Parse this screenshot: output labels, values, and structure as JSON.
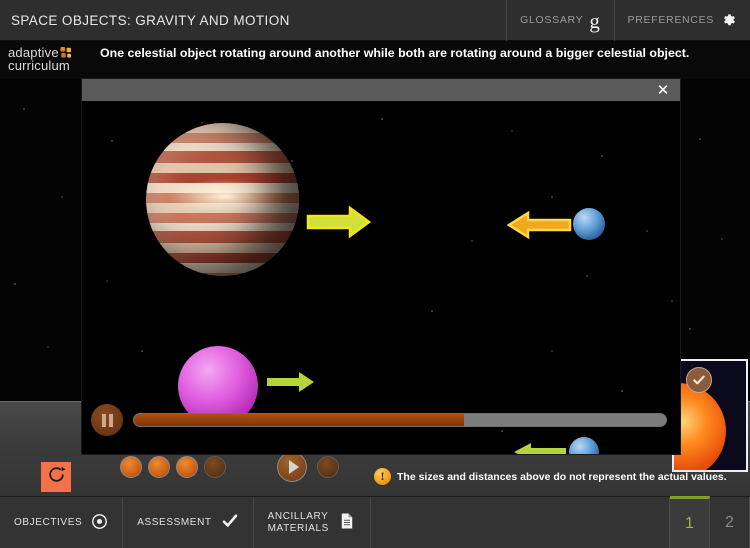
{
  "header": {
    "title": "SPACE OBJECTS: GRAVITY AND MOTION",
    "glossary_label": "GLOSSARY",
    "glossary_icon": "glossary-g-icon",
    "preferences_label": "PREFERENCES",
    "preferences_icon": "gear-icon"
  },
  "brand": {
    "line1": "adaptive",
    "line2": "curriculum",
    "mark_icon": "puzzle-mark-icon",
    "accent_color": "#f08a30"
  },
  "prompt": {
    "text": "One celestial object rotating around another while both are rotating around a bigger celestial object."
  },
  "modal": {
    "close_label": "✕",
    "scene": {
      "objects": [
        {
          "name": "jupiter-planet",
          "color": "#c9795f"
        },
        {
          "name": "blue-planet-top",
          "color": "#5f9fd6"
        },
        {
          "name": "neptune-planet",
          "color": "#e160e0"
        },
        {
          "name": "blue-planet-bottom",
          "color": "#5f9fd6"
        }
      ],
      "arrows": [
        {
          "name": "arrow-jupiter-right",
          "direction": "right",
          "color": "#b6d43a"
        },
        {
          "name": "arrow-blue-top-left",
          "direction": "left",
          "color": "#f0a81c"
        },
        {
          "name": "arrow-neptune-right",
          "direction": "right",
          "color": "#b6d43a"
        },
        {
          "name": "arrow-blue-bottom-left",
          "direction": "left",
          "color": "#b6d43a"
        }
      ]
    },
    "player": {
      "state_icon": "pause-icon",
      "progress_percent": 62
    }
  },
  "stage_controls": {
    "reset_icon": "reset-icon",
    "reset_color": "#f4714a",
    "steps": [
      {
        "name": "step-dot-1",
        "state": "on"
      },
      {
        "name": "step-dot-2",
        "state": "on"
      },
      {
        "name": "step-dot-3",
        "state": "on"
      },
      {
        "name": "step-dot-4",
        "state": "off"
      },
      {
        "name": "play-button",
        "state": "play"
      },
      {
        "name": "step-dot-5",
        "state": "off"
      }
    ],
    "warning_icon": "warning-exclamation-icon",
    "warning_text": "The sizes and distances above do not represent the actual values."
  },
  "sun_panel": {
    "check_icon": "check-icon",
    "body_name": "sun-image"
  },
  "bottom_nav": {
    "items": [
      {
        "label": "OBJECTIVES",
        "icon": "target-icon",
        "name": "nav-objectives"
      },
      {
        "label": "ASSESSMENT",
        "icon": "check-icon",
        "name": "nav-assessment"
      },
      {
        "label_line1": "ANCILLARY",
        "label_line2": "MATERIALS",
        "icon": "document-icon",
        "name": "nav-ancillary-materials"
      }
    ],
    "pages": [
      {
        "label": "1",
        "active": true
      },
      {
        "label": "2",
        "active": false
      }
    ],
    "active_accent": "#7f9e2a"
  }
}
